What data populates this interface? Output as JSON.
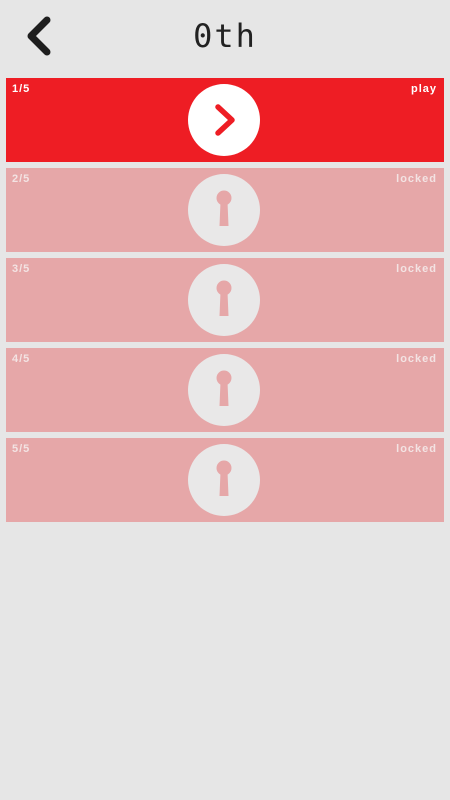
{
  "header": {
    "title": "0th",
    "back_icon": "chevron-left-icon"
  },
  "colors": {
    "active_row": "#ee1d24",
    "locked_row": "#e6a7a8",
    "background": "#e6e6e6"
  },
  "levels": [
    {
      "number": "1/5",
      "status": "play",
      "icon": "play-chevron-icon"
    },
    {
      "number": "2/5",
      "status": "locked",
      "icon": "keyhole-icon"
    },
    {
      "number": "3/5",
      "status": "locked",
      "icon": "keyhole-icon"
    },
    {
      "number": "4/5",
      "status": "locked",
      "icon": "keyhole-icon"
    },
    {
      "number": "5/5",
      "status": "locked",
      "icon": "keyhole-icon"
    }
  ]
}
